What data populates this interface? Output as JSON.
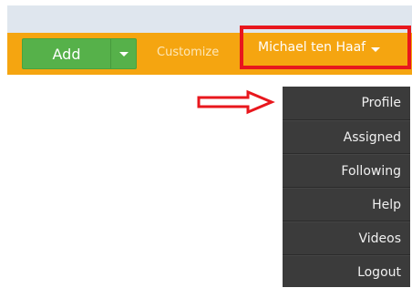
{
  "toolbar": {
    "add_label": "Add",
    "customize_label": "Customize",
    "user_name": "Michael ten Haaf"
  },
  "user_menu": {
    "items": [
      {
        "label": "Profile"
      },
      {
        "label": "Assigned"
      },
      {
        "label": "Following"
      },
      {
        "label": "Help"
      },
      {
        "label": "Videos"
      },
      {
        "label": "Logout"
      }
    ]
  },
  "colors": {
    "toolbar_bg": "#f5a510",
    "add_button_bg": "#56b14a",
    "menu_bg": "#3b3b3b",
    "highlight_red": "#e8171d"
  },
  "icons": {
    "add_dropdown": "caret-down-icon",
    "user_dropdown": "caret-down-icon",
    "annotation": "outline-arrow-right-icon"
  }
}
